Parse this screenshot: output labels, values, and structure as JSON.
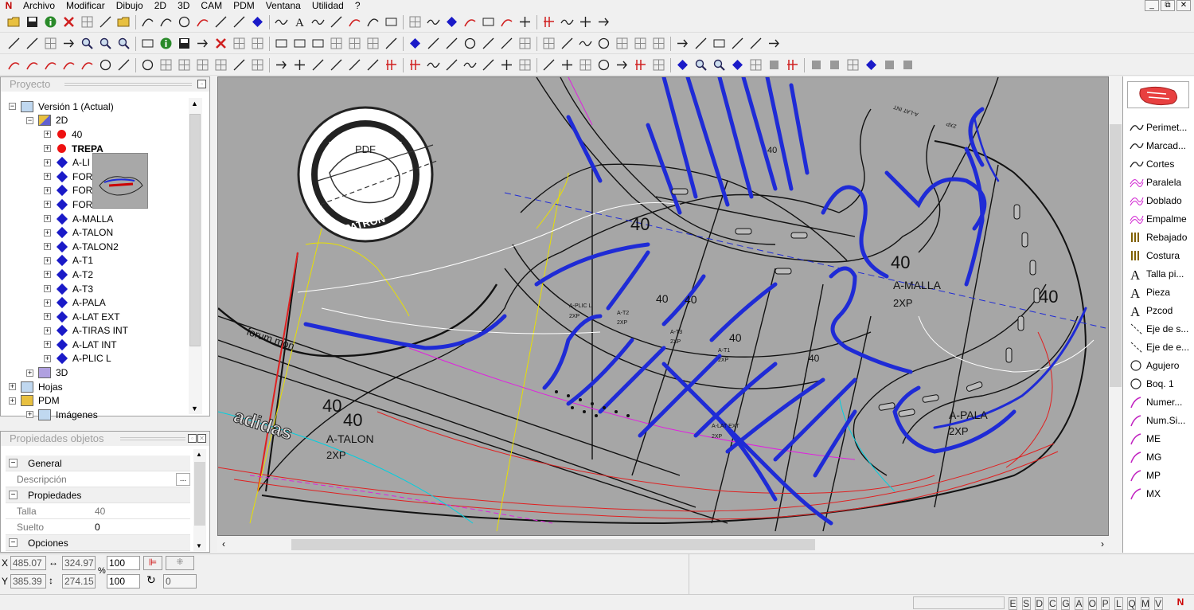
{
  "menubar": {
    "items": [
      "Archivo",
      "Modificar",
      "Dibujo",
      "2D",
      "3D",
      "CAM",
      "PDM",
      "Ventana",
      "Utilidad",
      "?"
    ],
    "window_buttons": [
      "_",
      "⧉",
      "✕"
    ]
  },
  "project_panel": {
    "title": "Proyecto",
    "tree": [
      {
        "label": "Versión 1 (Actual)",
        "level": 0,
        "icon": "folder-version-icon"
      },
      {
        "label": "2D",
        "level": 1,
        "icon": "layers-2d-icon"
      },
      {
        "label": "40",
        "level": 2,
        "icon": "red-dot",
        "bold": false
      },
      {
        "label": "TREPA",
        "level": 2,
        "icon": "red-dot",
        "bold": true
      },
      {
        "label": "A-LI",
        "level": 2,
        "icon": "blue-diamond"
      },
      {
        "label": "FOR",
        "level": 2,
        "icon": "blue-diamond"
      },
      {
        "label": "FOR",
        "level": 2,
        "icon": "blue-diamond"
      },
      {
        "label": "FOR",
        "level": 2,
        "icon": "blue-diamond"
      },
      {
        "label": "A-MALLA",
        "level": 2,
        "icon": "blue-diamond"
      },
      {
        "label": "A-TALON",
        "level": 2,
        "icon": "blue-diamond"
      },
      {
        "label": "A-TALON2",
        "level": 2,
        "icon": "blue-diamond"
      },
      {
        "label": "A-T1",
        "level": 2,
        "icon": "blue-diamond"
      },
      {
        "label": "A-T2",
        "level": 2,
        "icon": "blue-diamond"
      },
      {
        "label": "A-T3",
        "level": 2,
        "icon": "blue-diamond"
      },
      {
        "label": "A-PALA",
        "level": 2,
        "icon": "blue-diamond"
      },
      {
        "label": "A-LAT EXT",
        "level": 2,
        "icon": "blue-diamond"
      },
      {
        "label": "A-TIRAS INT",
        "level": 2,
        "icon": "blue-diamond"
      },
      {
        "label": "A-LAT INT",
        "level": 2,
        "icon": "blue-diamond"
      },
      {
        "label": "A-PLIC L",
        "level": 2,
        "icon": "blue-diamond"
      },
      {
        "label": "3D",
        "level": 1,
        "icon": "cube-3d-icon"
      },
      {
        "label": "Hojas",
        "level": 0,
        "icon": "sheets-icon"
      },
      {
        "label": "PDM",
        "level": 0,
        "icon": "folder-icon"
      },
      {
        "label": "Imágenes",
        "level": 1,
        "icon": "images-icon"
      }
    ]
  },
  "properties_panel": {
    "title": "Propiedades objetos",
    "rows": [
      {
        "type": "group",
        "label": "General"
      },
      {
        "type": "prop",
        "label": "Descripción",
        "value": "",
        "button": "..."
      },
      {
        "type": "group",
        "label": "Propiedades"
      },
      {
        "type": "prop",
        "label": "Talla",
        "value": "40",
        "muted": true
      },
      {
        "type": "prop",
        "label": "Suelto",
        "value": "0"
      },
      {
        "type": "group",
        "label": "Opciones"
      }
    ]
  },
  "canvas": {
    "watermark": {
      "top": "PERFOMANCE",
      "mid": "PDF",
      "bottom": "PATRON"
    },
    "labels": [
      {
        "text": "40",
        "size": 22
      },
      {
        "text": "40",
        "size": 22
      },
      {
        "text": "A-MALLA",
        "size": 14
      },
      {
        "text": "2XP",
        "size": 13
      },
      {
        "text": "40",
        "size": 22
      },
      {
        "text": "40",
        "size": 22
      },
      {
        "text": "40",
        "size": 22
      },
      {
        "text": "A-TALON",
        "size": 14
      },
      {
        "text": "2XP",
        "size": 13
      },
      {
        "text": "A-PALA",
        "size": 14
      },
      {
        "text": "2XP",
        "size": 13
      },
      {
        "text": "40",
        "size": 14
      },
      {
        "text": "40",
        "size": 14
      },
      {
        "text": "40",
        "size": 14
      },
      {
        "text": "40",
        "size": 12
      },
      {
        "text": "A-PLIC L",
        "size": 7
      },
      {
        "text": "2XP",
        "size": 7
      },
      {
        "text": "A-T2",
        "size": 7
      },
      {
        "text": "2XP",
        "size": 7
      },
      {
        "text": "A-T3",
        "size": 7
      },
      {
        "text": "2XP",
        "size": 7
      },
      {
        "text": "A-T1",
        "size": 7
      },
      {
        "text": "2XP",
        "size": 7
      },
      {
        "text": "A-LAT EXT",
        "size": 7
      },
      {
        "text": "2XP",
        "size": 7
      },
      {
        "text": "forum mon",
        "size": 13
      },
      {
        "text": "adidas",
        "size": 24
      },
      {
        "text": "40",
        "size": 11
      },
      {
        "text": "A-LAT INT",
        "size": 7
      },
      {
        "text": "2XP",
        "size": 7
      }
    ]
  },
  "right_panel": {
    "items": [
      {
        "label": "Perimet...",
        "icon": "perimeter-curve-icon"
      },
      {
        "label": "Marcad...",
        "icon": "marker-curve-icon"
      },
      {
        "label": "Cortes",
        "icon": "cut-curve-icon"
      },
      {
        "label": "Paralela",
        "icon": "parallel-curve-icon"
      },
      {
        "label": "Doblado",
        "icon": "fold-curve-icon"
      },
      {
        "label": "Empalme",
        "icon": "splice-curve-icon"
      },
      {
        "label": "Rebajado",
        "icon": "skive-icon"
      },
      {
        "label": "Costura",
        "icon": "seam-icon"
      },
      {
        "label": "Talla pi...",
        "icon": "text-a-icon"
      },
      {
        "label": "Pieza",
        "icon": "text-a-icon"
      },
      {
        "label": "Pzcod",
        "icon": "text-a-icon"
      },
      {
        "label": "Eje de s...",
        "icon": "axis-line-icon"
      },
      {
        "label": "Eje de e...",
        "icon": "axis-line-icon"
      },
      {
        "label": "Agujero",
        "icon": "hole-circle-icon"
      },
      {
        "label": "Boq. 1",
        "icon": "hole-circle-icon"
      },
      {
        "label": "Numer...",
        "icon": "numbering-icon"
      },
      {
        "label": "Num.Si...",
        "icon": "numbering-icon"
      },
      {
        "label": "ME",
        "icon": "mark-icon"
      },
      {
        "label": "MG",
        "icon": "mark-icon"
      },
      {
        "label": "MP",
        "icon": "mark-icon"
      },
      {
        "label": "MX",
        "icon": "mark-icon"
      }
    ]
  },
  "coords": {
    "x_label": "X",
    "y_label": "Y",
    "x1": "485.07",
    "x2": "324.97",
    "y1": "385.39",
    "y2": "274.15",
    "scale_x": "100",
    "scale_y": "100",
    "angle": "0",
    "percent": "%"
  },
  "status": {
    "letters": [
      "E",
      "S",
      "D",
      "C",
      "G",
      "A",
      "O",
      "P",
      "L",
      "Q",
      "M",
      "V"
    ]
  },
  "colors": {
    "canvas_bg": "#a6a6a6",
    "piece_blue": "#1f2bd6",
    "accent_red": "#e02020"
  }
}
